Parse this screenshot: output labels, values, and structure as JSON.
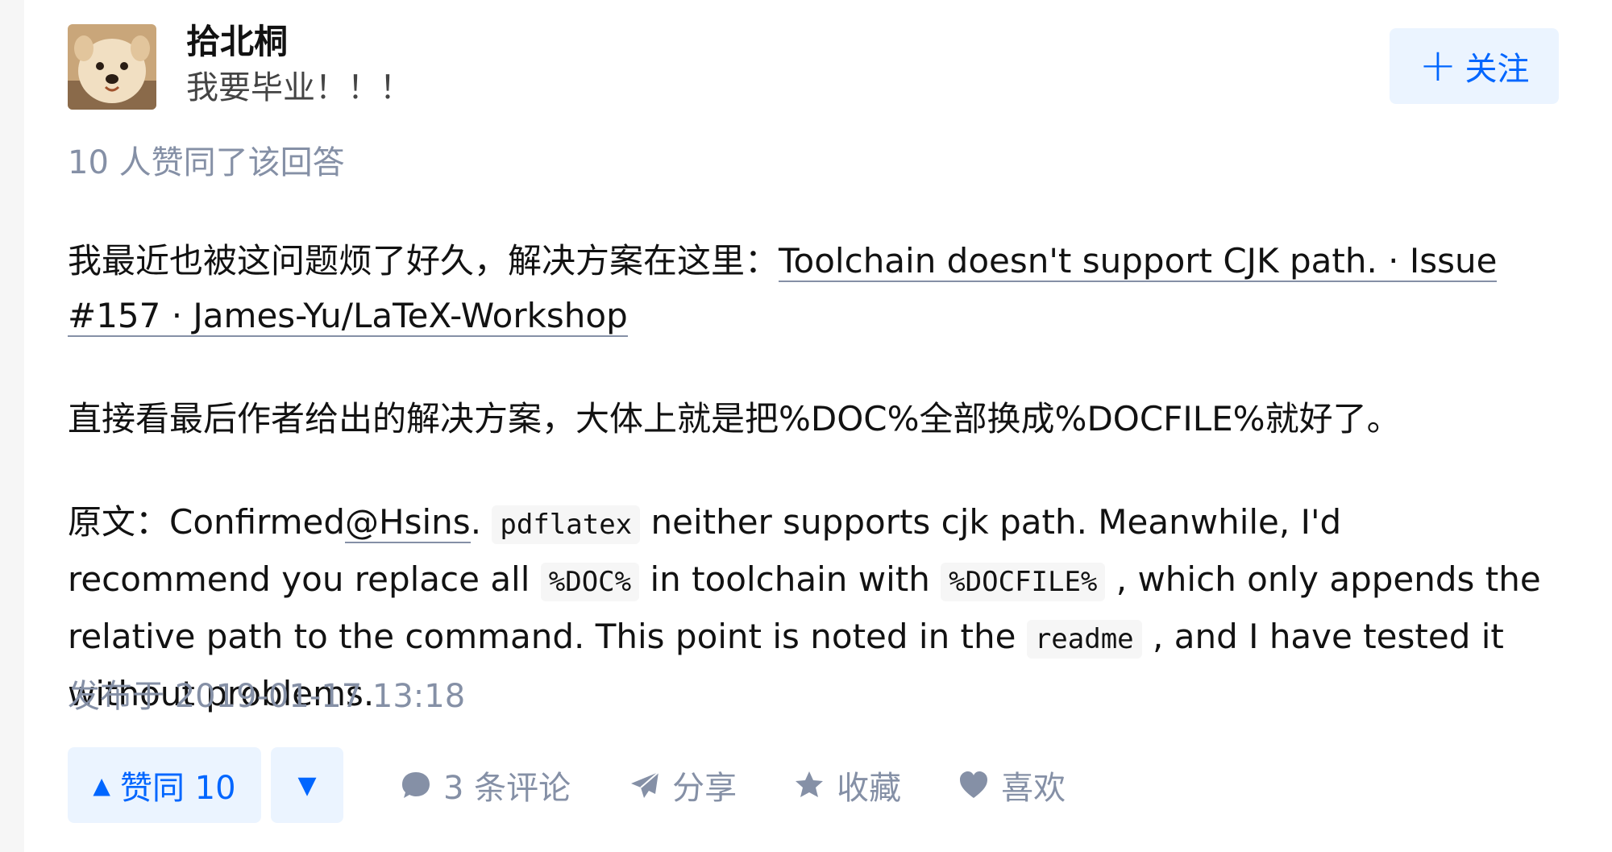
{
  "author": {
    "name": "拾北桐",
    "bio": "我要毕业！！！",
    "follow_label": "关注"
  },
  "vote_summary": "10 人赞同了该回答",
  "content": {
    "p1_prefix": "我最近也被这问题烦了好久，解决方案在这里：",
    "p1_link": "Toolchain doesn't support CJK path. · Issue #157 · James-Yu/LaTeX-Workshop",
    "p2": "直接看最后作者给出的解决方案，大体上就是把%DOC%全部换成%DOCFILE%就好了。",
    "p3_prefix": "原文：Confirmed",
    "p3_mention": "@Hsins",
    "p3_dot": ". ",
    "p3_code1": "pdflatex",
    "p3_text1": " neither supports cjk path. Meanwhile, I'd recommend you replace all ",
    "p3_code2": "%DOC%",
    "p3_text2": " in toolchain with ",
    "p3_code3": "%DOCFILE%",
    "p3_text3": " , which only appends the relative path to the command. This point is noted in the ",
    "p3_code4": "readme",
    "p3_text4": " , and I have tested it without problems."
  },
  "timestamp": "发布于 2019-01-17 13:18",
  "actions": {
    "vote_up_label": "赞同 10",
    "comment_label": "3 条评论",
    "share_label": "分享",
    "favorite_label": "收藏",
    "like_label": "喜欢"
  },
  "colors": {
    "accent": "#0066ff",
    "accent_bg": "#ebf4ff",
    "meta_text": "#8590a6"
  }
}
